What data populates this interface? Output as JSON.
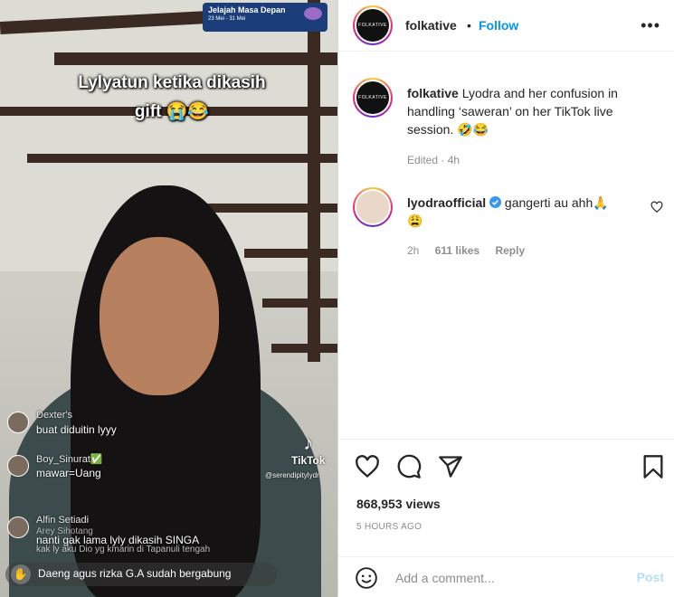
{
  "video": {
    "banner_title": "Jelajah Masa Depan",
    "banner_dates": "23 Mei - 31 Mei",
    "caption_line1": "Lylyatun ketika dikasih",
    "caption_line2": "gift 😭😂",
    "comments": [
      {
        "name": "Dexter's",
        "text": "buat diduitin lyyy"
      },
      {
        "name": "Boy_Sinurat✅",
        "text": "mawar=Uang"
      },
      {
        "name": "Alfin Setiadi",
        "text": "nanti gak lama lyly dikasih SINGA"
      },
      {
        "name": "Arey Sihotang",
        "text": "kak ly aku Dio yg kmarin di Tapanuli tengah"
      }
    ],
    "tiktok_label": "TikTok",
    "tiktok_user": "@serendipitylydr",
    "join_text": "Daeng agus rizka G.A sudah bergabung"
  },
  "post": {
    "username": "folkative",
    "avatar_text": "FOLKATIVE",
    "follow_label": "Follow",
    "separator": "•",
    "more_label": "•••",
    "caption": "Lyodra and her confusion in handling ‘saweran’ on her TikTok live session. 🤣😂",
    "caption_meta": "Edited · 4h",
    "comment": {
      "username": "lyodraofficial",
      "text": "gangerti au ahh🙏",
      "emoji_line": "😩",
      "time": "2h",
      "likes": "611 likes",
      "reply": "Reply"
    },
    "views": "868,953 views",
    "time_ago": "5 HOURS AGO",
    "comment_placeholder": "Add a comment...",
    "post_label": "Post"
  },
  "colors": {
    "accent": "#0095f6",
    "post_disabled": "#b2dffc",
    "verified": "#3897f0",
    "meta_text": "#8e8e8e"
  },
  "icons": [
    "heart-icon",
    "comment-icon",
    "share-icon",
    "bookmark-icon",
    "emoji-icon",
    "more-icon",
    "verified-badge-icon"
  ]
}
